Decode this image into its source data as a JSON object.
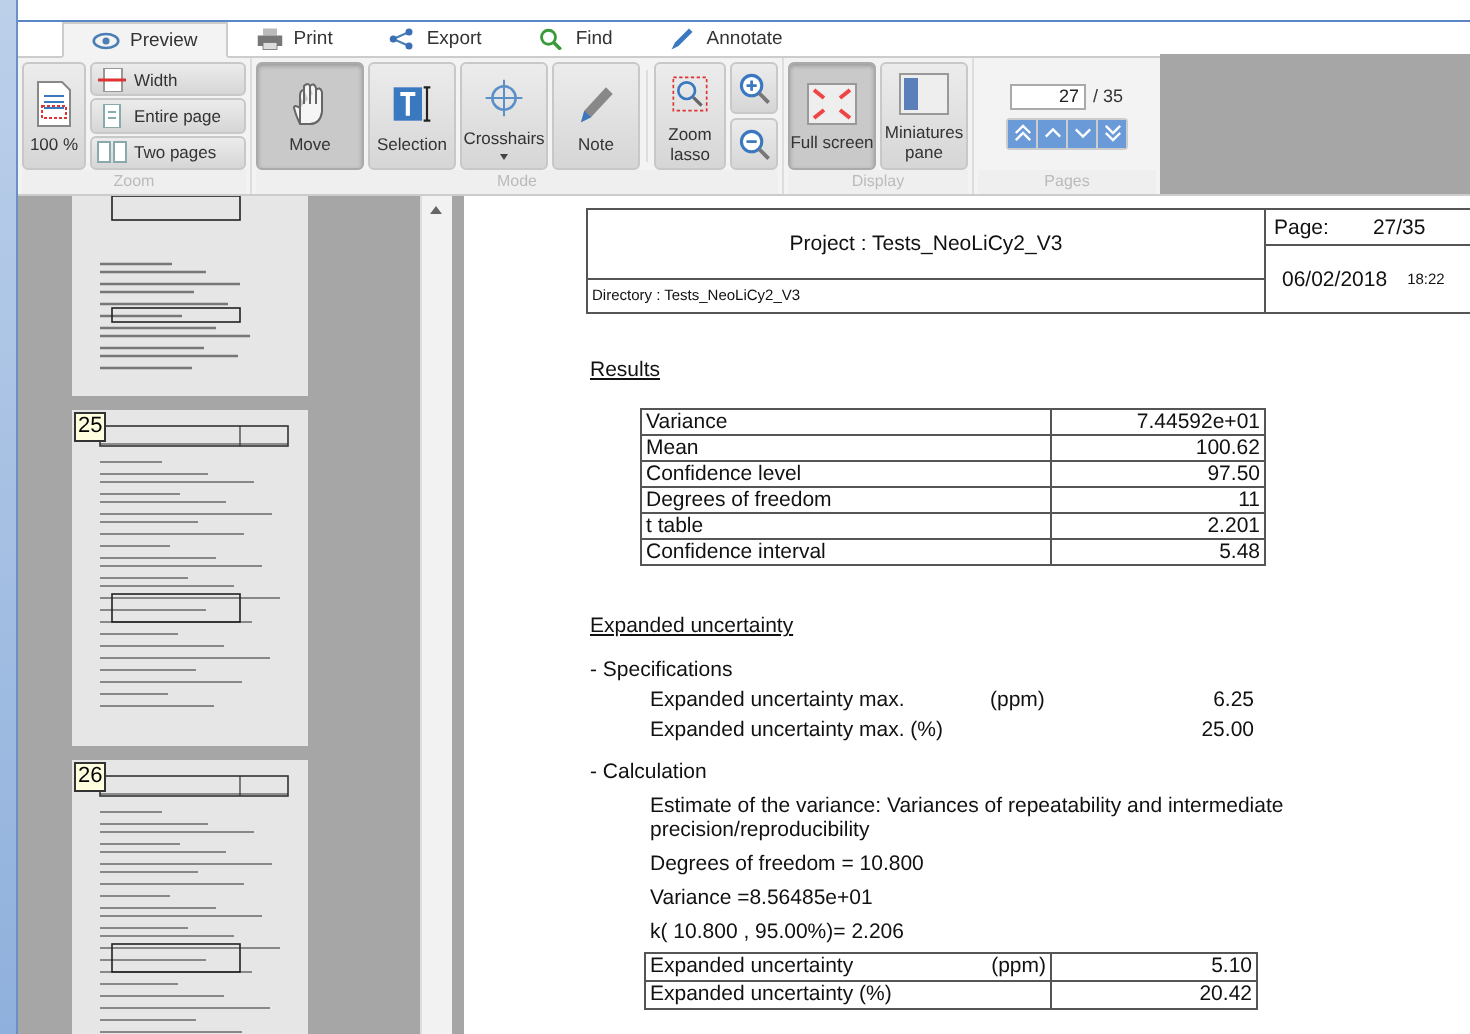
{
  "tabs": [
    {
      "label": "Preview",
      "kind": "eye",
      "selected": true
    },
    {
      "label": "Print",
      "kind": "printer",
      "selected": false
    },
    {
      "label": "Export",
      "kind": "share",
      "selected": false
    },
    {
      "label": "Find",
      "kind": "search",
      "selected": false
    },
    {
      "label": "Annotate",
      "kind": "pen",
      "selected": false
    }
  ],
  "ribbon": {
    "zoom": {
      "label": "Zoom",
      "percent": "100 %",
      "options": [
        {
          "label": "Width",
          "kind": "width"
        },
        {
          "label": "Entire page",
          "kind": "page"
        },
        {
          "label": "Two pages",
          "kind": "pages"
        }
      ]
    },
    "mode": {
      "label": "Mode",
      "tools": [
        {
          "label": "Move",
          "kind": "hand",
          "selected": true,
          "dropdown": false
        },
        {
          "label": "Selection",
          "kind": "text",
          "selected": false,
          "dropdown": false
        },
        {
          "label": "Crosshairs",
          "kind": "crosshair",
          "selected": false,
          "dropdown": true
        },
        {
          "label": "Note",
          "kind": "pen",
          "selected": false,
          "dropdown": false
        }
      ],
      "lasso": "Zoom lasso"
    },
    "display": {
      "label": "Display",
      "buttons": [
        {
          "label": "Full screen",
          "kind": "fullscreen",
          "on": true
        },
        {
          "label": "Miniatures pane",
          "kind": "pane",
          "on": false
        }
      ]
    },
    "pages": {
      "label": "Pages",
      "current": "27",
      "total": "/ 35"
    }
  },
  "thumbnails": [
    "25",
    "26"
  ],
  "document": {
    "project": "Project : Tests_NeoLiCy2_V3",
    "directory": "Directory : Tests_NeoLiCy2_V3",
    "page_label": "Page:",
    "page": "27/35",
    "date": "06/02/2018",
    "time": "18:22",
    "results_title": "Results",
    "results": [
      {
        "name": "Variance",
        "value": "7.44592e+01"
      },
      {
        "name": "Mean",
        "value": "100.62"
      },
      {
        "name": "Confidence level",
        "value": "97.50"
      },
      {
        "name": "Degrees of freedom",
        "value": "11"
      },
      {
        "name": "t table",
        "value": "2.201"
      },
      {
        "name": "Confidence interval",
        "value": "5.48"
      }
    ],
    "uncertainty_title": "Expanded uncertainty",
    "specifications_title": "- Specifications",
    "specifications": [
      {
        "name": "Expanded uncertainty max.",
        "unit": "(ppm)",
        "value": "6.25"
      },
      {
        "name": "Expanded uncertainty max. (%)",
        "value": "25.00"
      }
    ],
    "calculation_title": "- Calculation",
    "calculation_lines": [
      "Estimate of the variance: Variances of repeatability and intermediate precision/reproducibility",
      "Degrees of freedom = 10.800",
      "Variance =8.56485e+01",
      "k( 10.800 ,  95.00%)= 2.206"
    ],
    "uncertainty": [
      {
        "name": "Expanded uncertainty",
        "unit": "(ppm)",
        "value": "5.10"
      },
      {
        "name": "Expanded uncertainty (%)",
        "value": "20.42"
      }
    ]
  }
}
